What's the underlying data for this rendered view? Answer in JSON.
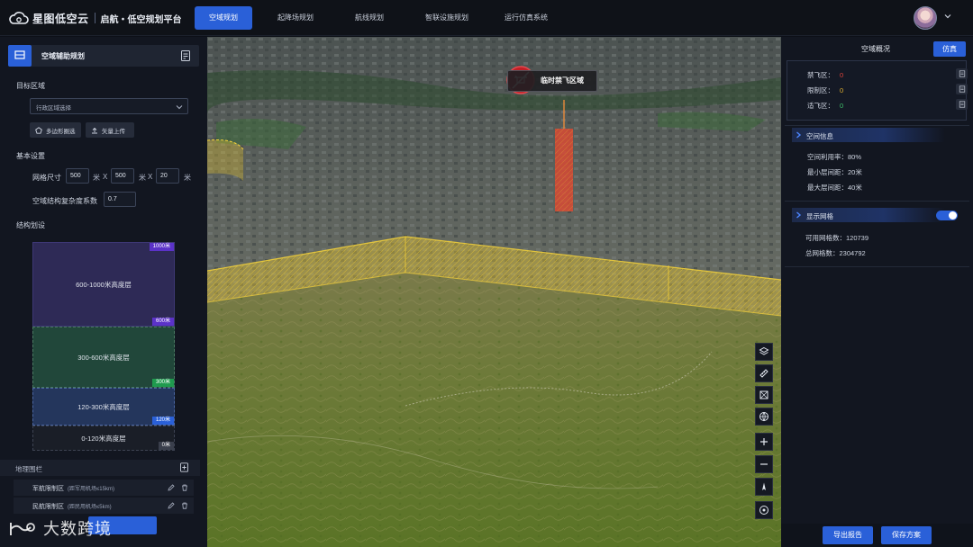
{
  "app": {
    "brand": "星图低空云",
    "title": "启航・低空规划平台"
  },
  "nav": {
    "items": [
      {
        "label": "空域规划",
        "active": true
      },
      {
        "label": "起降场规划",
        "active": false
      },
      {
        "label": "航线规划",
        "active": false
      },
      {
        "label": "智联设施规划",
        "active": false
      },
      {
        "label": "运行仿真系统",
        "active": false
      }
    ]
  },
  "left": {
    "panel_title": "空域辅助规划",
    "target_area": {
      "label": "目标区域",
      "select_placeholder": "行政区域选择",
      "btn_polygon": "多边形圈选",
      "btn_upload": "矢量上传"
    },
    "basic": {
      "label": "基本设置",
      "grid_label": "网格尺寸",
      "grid_x": "500",
      "grid_y": "500",
      "grid_z": "20",
      "unit_m": "米",
      "times": "X",
      "complexity_label": "空域结构复杂度系数",
      "complexity_value": "0.7"
    },
    "structure": {
      "label": "结构划设",
      "layers": [
        {
          "name": "600-1000米高度层",
          "tag": "600米",
          "color": "#2e2a56",
          "tag_color": "#5b32c8"
        },
        {
          "name": "300-600米高度层",
          "tag": "300米",
          "color": "#21473a",
          "tag_color": "#1f9a4e"
        },
        {
          "name": "120-300米高度层",
          "tag": "120米",
          "color": "#24365c",
          "tag_color": "#2a60d8"
        },
        {
          "name": "0-120米高度层",
          "tag": "0米",
          "color": "#1a1e27",
          "tag_color": "#3a3f4c"
        }
      ],
      "top_tag": "1000米"
    },
    "geofence": {
      "label": "地理围栏",
      "rows": [
        {
          "name": "军航限制区",
          "sub": "(距军用机场≤15km)"
        },
        {
          "name": "民航限制区",
          "sub": "(距民用机场≤5km)"
        }
      ]
    }
  },
  "map": {
    "nofly_label": "临时禁飞区域"
  },
  "right": {
    "tab_overview": "空域概况",
    "tab_sim": "仿真",
    "zones": [
      {
        "label": "禁飞区：",
        "value": "0",
        "color": "#e0443a"
      },
      {
        "label": "限制区：",
        "value": "0",
        "color": "#e0b030"
      },
      {
        "label": "适飞区：",
        "value": "0",
        "color": "#3ec06a"
      }
    ],
    "space_info": {
      "title": "空间信息",
      "stats": [
        "空间利用率：80%",
        "最小层间距：20米",
        "最大层间距：40米"
      ]
    },
    "grid": {
      "title": "显示网格",
      "toggle_on": true,
      "stats": [
        "可用网格数：120739",
        "总网格数：2304792"
      ]
    },
    "btn_export": "导出报告",
    "btn_save": "保存方案"
  },
  "watermark": {
    "text": "大数跨境"
  }
}
